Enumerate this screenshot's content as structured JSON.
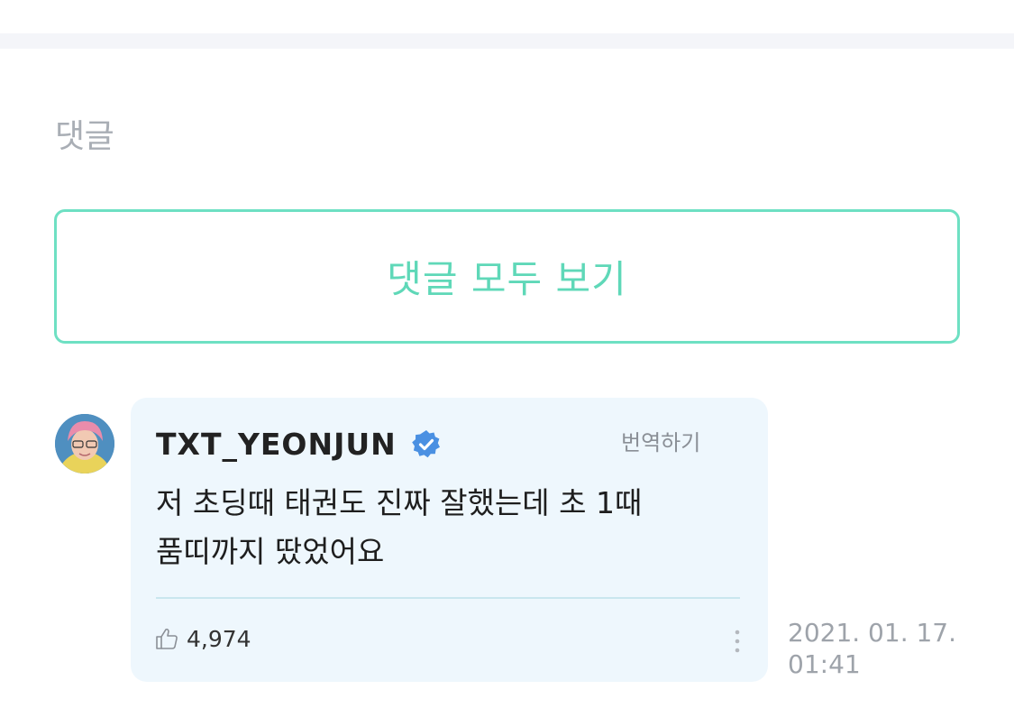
{
  "comments_section": {
    "title": "댓글",
    "view_all_label": "댓글 모두 보기"
  },
  "comment": {
    "author": "TXT_YEONJUN",
    "verified": true,
    "translate_label": "번역하기",
    "text": "저 초딩때 태권도 진짜 잘했는데 초 1때 품띠까지 땄었어요",
    "like_count": "4,974",
    "date": "2021. 01. 17.",
    "time": "01:41"
  },
  "colors": {
    "accent": "#6ee0c3",
    "card_bg": "#eef7fd",
    "verified_badge": "#4a90e2",
    "muted_text": "#9ea3aa"
  },
  "icons": {
    "verified": "verified-badge-icon",
    "like": "thumbs-up-icon",
    "more": "more-vertical-icon"
  }
}
